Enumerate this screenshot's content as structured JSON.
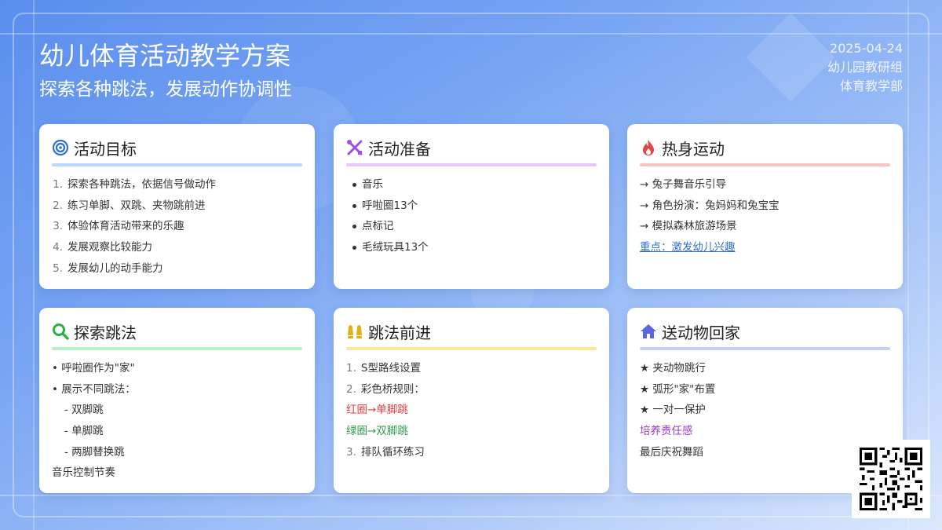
{
  "header": {
    "title": "幼儿体育活动教学方案",
    "subtitle": "探索各种跳法，发展动作协调性",
    "date": "2025-04-24",
    "org1": "幼儿园教研组",
    "org2": "体育教学部"
  },
  "cards": [
    {
      "icon": "target-icon",
      "title": "活动目标",
      "accent": "#b9d6fb",
      "items": [
        {
          "num": "1.",
          "text": "探索各种跳法，依据信号做动作"
        },
        {
          "num": "2.",
          "text": "练习单脚、双跳、夹物跳前进"
        },
        {
          "num": "3.",
          "text": "体验体育活动带来的乐趣"
        },
        {
          "num": "4.",
          "text": "发展观察比较能力"
        },
        {
          "num": "5.",
          "text": "发展幼儿的动手能力"
        }
      ]
    },
    {
      "icon": "tools-icon",
      "title": "活动准备",
      "accent": "#e3c9f5",
      "items": [
        "音乐",
        "呼啦圈13个",
        "点标记",
        "毛绒玩具13个"
      ]
    },
    {
      "icon": "fire-icon",
      "title": "热身运动",
      "accent": "#f8c4c4",
      "items": [
        "→ 兔子舞音乐引导",
        "→ 角色扮演：兔妈妈和兔宝宝",
        "→ 模拟森林旅游场景"
      ],
      "link": "重点：激发幼儿兴趣"
    },
    {
      "icon": "search-icon",
      "title": "探索跳法",
      "accent": "#b7f0c4",
      "items": [
        "• 呼啦圈作为\"家\"",
        "• 展示不同跳法：",
        "- 双脚跳",
        "- 单脚跳",
        "- 两脚替换跳",
        "音乐控制节奏"
      ]
    },
    {
      "icon": "footprints-icon",
      "title": "跳法前进",
      "accent": "#fde59a",
      "items": [
        {
          "num": "1.",
          "text": "S型路线设置"
        },
        {
          "num": "2.",
          "text": "彩色桥规则："
        },
        {
          "text": "红圈→单脚跳"
        },
        {
          "text": "绿圈→双脚跳"
        },
        {
          "num": "3.",
          "text": "排队循环练习"
        }
      ]
    },
    {
      "icon": "home-icon",
      "title": "送动物回家",
      "accent": "#c4cff5",
      "items": [
        "★ 夹动物跳行",
        "★ 弧形\"家\"布置",
        "★ 一对一保护",
        "培养责任感",
        "最后庆祝舞蹈"
      ]
    }
  ],
  "colors": {
    "blue_icon": "#2f6fd6",
    "purple_icon": "#a14fe0",
    "red_icon": "#e84343",
    "green_icon": "#2bb34a",
    "yellow_icon": "#e0b014",
    "indigo_icon": "#5a67e0"
  },
  "qr": {
    "icon": "qr-code-icon"
  }
}
